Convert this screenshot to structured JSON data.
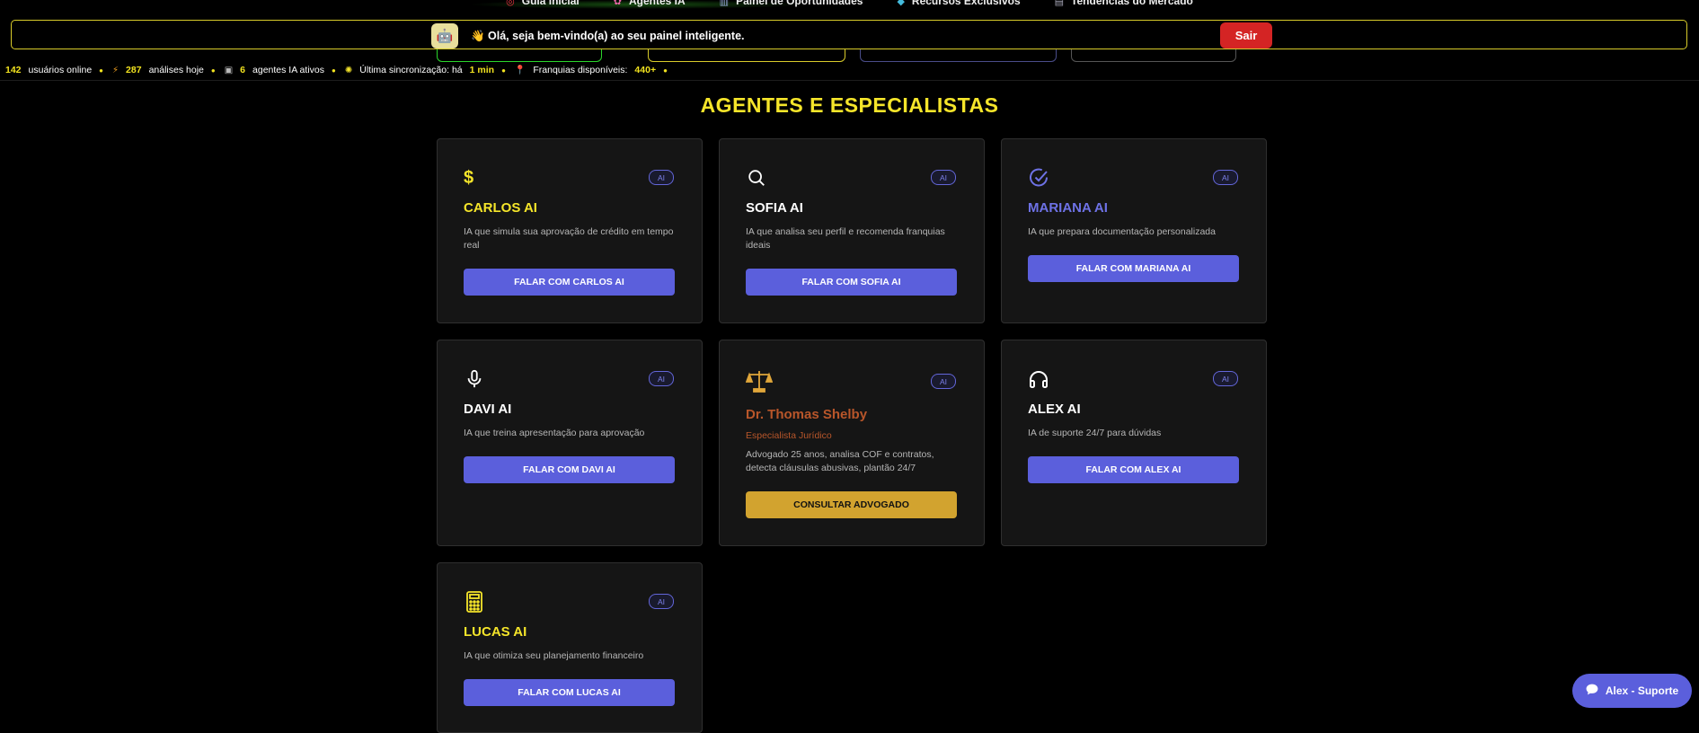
{
  "nav": {
    "items": [
      {
        "icon": "target-icon",
        "glyph": "◎",
        "label": "Guia Inicial"
      },
      {
        "icon": "brain-icon",
        "glyph": "✿",
        "label": "Agentes IA"
      },
      {
        "icon": "chart-icon",
        "glyph": "▥",
        "label": "Painel de Oportunidades"
      },
      {
        "icon": "diamond-icon",
        "glyph": "◆",
        "label": "Recursos Exclusivos"
      },
      {
        "icon": "trend-icon",
        "glyph": "▤",
        "label": "Tendências do Mercado"
      }
    ]
  },
  "banner": {
    "avatar_glyph": "🤖",
    "welcome": "👋 Olá, seja bem-vindo(a) ao seu painel inteligente.",
    "logout_label": "Sair"
  },
  "ticker": {
    "online_count": "142",
    "online_label": "usuários online",
    "analyses_count": "287",
    "analyses_label": "análises hoje",
    "agents_count": "6",
    "agents_label": "agentes IA ativos",
    "sync_label": "Última sincronização: há",
    "sync_value": "1 min",
    "franchises_label": "Franquias disponíveis:",
    "franchises_value": "440+"
  },
  "section": {
    "title": "AGENTES E ESPECIALISTAS"
  },
  "agents": [
    {
      "name": "CARLOS AI",
      "desc": "IA que simula sua aprovação de crédito em tempo real",
      "button": "FALAR COM CARLOS AI",
      "badge": "AI",
      "icon": "dollar-icon",
      "color": "#f5e52a"
    },
    {
      "name": "SOFIA AI",
      "desc": "IA que analisa seu perfil e recomenda franquias ideais",
      "button": "FALAR COM SOFIA AI",
      "badge": "AI",
      "icon": "search-icon",
      "color": "#ffffff"
    },
    {
      "name": "MARIANA AI",
      "desc": "IA que prepara documentação personalizada",
      "button": "FALAR COM MARIANA AI",
      "badge": "AI",
      "icon": "check-circle-icon",
      "color": "#6e72e6"
    },
    {
      "name": "DAVI AI",
      "desc": "IA que treina apresentação para aprovação",
      "button": "FALAR COM DAVI AI",
      "badge": "AI",
      "icon": "microphone-icon",
      "color": "#ffffff"
    },
    {
      "name": "Dr. Thomas Shelby",
      "subtitle": "Especialista Jurídico",
      "desc": "Advogado 25 anos, analisa COF e contratos, detecta cláusulas abusivas, plantão 24/7",
      "button": "CONSULTAR ADVOGADO",
      "badge": "AI",
      "icon": "scales-icon",
      "color": "#b8562a"
    },
    {
      "name": "ALEX AI",
      "desc": "IA de suporte 24/7 para dúvidas",
      "button": "FALAR COM ALEX AI",
      "badge": "AI",
      "icon": "headphones-icon",
      "color": "#ffffff"
    },
    {
      "name": "LUCAS AI",
      "desc": "IA que otimiza seu planejamento financeiro",
      "button": "FALAR COM LUCAS AI",
      "badge": "AI",
      "icon": "calculator-icon",
      "color": "#f5e52a"
    }
  ],
  "support": {
    "label": "Alex - Suporte",
    "icon": "chat-icon"
  }
}
